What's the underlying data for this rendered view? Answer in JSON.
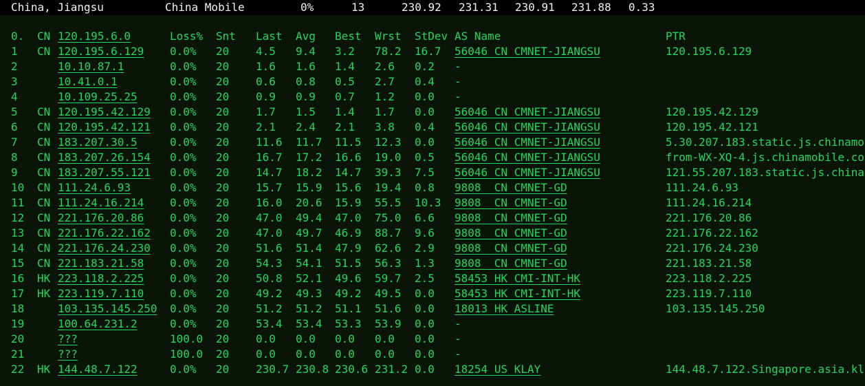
{
  "summary": {
    "location": "China, Jiangsu",
    "isp": "China Mobile",
    "loss": "0%",
    "sent": "13",
    "last": "230.92",
    "avg": "231.31",
    "best": "230.91",
    "worst": "231.88",
    "stdev": "0.33"
  },
  "colors": {
    "terminal_bg": "#0b1409",
    "topbar_bg": "#000000",
    "text_green": "#22d85a",
    "text_white": "#e8e8e8"
  },
  "header": {
    "hop": "0.",
    "cc": "CN",
    "host": "120.195.6.0",
    "loss": "Loss%",
    "snt": "Snt",
    "last": "Last",
    "avg": "Avg",
    "best": "Best",
    "wrst": "Wrst",
    "stdev": "StDev",
    "asname": "AS Name",
    "ptr": "PTR"
  },
  "hops": [
    {
      "hop": "1",
      "cc": "CN",
      "host": "120.195.6.129",
      "loss": "0.0%",
      "snt": "20",
      "last": "4.5",
      "avg": "9.4",
      "best": "3.2",
      "wrst": "78.2",
      "stdev": "16.7",
      "asn": "56046",
      "ascc": "CN",
      "asname": "CMNET-JIANGSU",
      "ptr": "120.195.6.129"
    },
    {
      "hop": "2",
      "cc": "",
      "host": "10.10.87.1",
      "loss": "0.0%",
      "snt": "20",
      "last": "1.6",
      "avg": "1.6",
      "best": "1.4",
      "wrst": "2.6",
      "stdev": "0.2",
      "asn": "-",
      "ascc": "",
      "asname": "",
      "ptr": ""
    },
    {
      "hop": "3",
      "cc": "",
      "host": "10.41.0.1",
      "loss": "0.0%",
      "snt": "20",
      "last": "0.6",
      "avg": "0.8",
      "best": "0.5",
      "wrst": "2.7",
      "stdev": "0.4",
      "asn": "-",
      "ascc": "",
      "asname": "",
      "ptr": ""
    },
    {
      "hop": "4",
      "cc": "",
      "host": "10.109.25.25",
      "loss": "0.0%",
      "snt": "20",
      "last": "0.9",
      "avg": "0.9",
      "best": "0.7",
      "wrst": "1.2",
      "stdev": "0.0",
      "asn": "-",
      "ascc": "",
      "asname": "",
      "ptr": ""
    },
    {
      "hop": "5",
      "cc": "CN",
      "host": "120.195.42.129",
      "loss": "0.0%",
      "snt": "20",
      "last": "1.7",
      "avg": "1.5",
      "best": "1.4",
      "wrst": "1.7",
      "stdev": "0.0",
      "asn": "56046",
      "ascc": "CN",
      "asname": "CMNET-JIANGSU",
      "ptr": "120.195.42.129"
    },
    {
      "hop": "6",
      "cc": "CN",
      "host": "120.195.42.121",
      "loss": "0.0%",
      "snt": "20",
      "last": "2.1",
      "avg": "2.4",
      "best": "2.1",
      "wrst": "3.8",
      "stdev": "0.4",
      "asn": "56046",
      "ascc": "CN",
      "asname": "CMNET-JIANGSU",
      "ptr": "120.195.42.121"
    },
    {
      "hop": "7",
      "cc": "CN",
      "host": "183.207.30.5",
      "loss": "0.0%",
      "snt": "20",
      "last": "11.6",
      "avg": "11.7",
      "best": "11.5",
      "wrst": "12.3",
      "stdev": "0.0",
      "asn": "56046",
      "ascc": "CN",
      "asname": "CMNET-JIANGSU",
      "ptr": "5.30.207.183.static.js.chinamo"
    },
    {
      "hop": "8",
      "cc": "CN",
      "host": "183.207.26.154",
      "loss": "0.0%",
      "snt": "20",
      "last": "16.7",
      "avg": "17.2",
      "best": "16.6",
      "wrst": "19.0",
      "stdev": "0.5",
      "asn": "56046",
      "ascc": "CN",
      "asname": "CMNET-JIANGSU",
      "ptr": "from-WX-XQ-4.js.chinamobile.co"
    },
    {
      "hop": "9",
      "cc": "CN",
      "host": "183.207.55.121",
      "loss": "0.0%",
      "snt": "20",
      "last": "14.7",
      "avg": "18.2",
      "best": "14.7",
      "wrst": "39.3",
      "stdev": "7.5",
      "asn": "56046",
      "ascc": "CN",
      "asname": "CMNET-JIANGSU",
      "ptr": "121.55.207.183.static.js.china"
    },
    {
      "hop": "10",
      "cc": "CN",
      "host": "111.24.6.93",
      "loss": "0.0%",
      "snt": "20",
      "last": "15.7",
      "avg": "15.9",
      "best": "15.6",
      "wrst": "19.4",
      "stdev": "0.8",
      "asn": "9808",
      "ascc": "CN",
      "asname": "CMNET-GD",
      "ptr": "111.24.6.93"
    },
    {
      "hop": "11",
      "cc": "CN",
      "host": "111.24.16.214",
      "loss": "0.0%",
      "snt": "20",
      "last": "16.0",
      "avg": "20.6",
      "best": "15.9",
      "wrst": "55.5",
      "stdev": "10.3",
      "asn": "9808",
      "ascc": "CN",
      "asname": "CMNET-GD",
      "ptr": "111.24.16.214"
    },
    {
      "hop": "12",
      "cc": "CN",
      "host": "221.176.20.86",
      "loss": "0.0%",
      "snt": "20",
      "last": "47.0",
      "avg": "49.4",
      "best": "47.0",
      "wrst": "75.0",
      "stdev": "6.6",
      "asn": "9808",
      "ascc": "CN",
      "asname": "CMNET-GD",
      "ptr": "221.176.20.86"
    },
    {
      "hop": "13",
      "cc": "CN",
      "host": "221.176.22.162",
      "loss": "0.0%",
      "snt": "20",
      "last": "47.0",
      "avg": "49.7",
      "best": "46.9",
      "wrst": "88.7",
      "stdev": "9.6",
      "asn": "9808",
      "ascc": "CN",
      "asname": "CMNET-GD",
      "ptr": "221.176.22.162"
    },
    {
      "hop": "14",
      "cc": "CN",
      "host": "221.176.24.230",
      "loss": "0.0%",
      "snt": "20",
      "last": "51.6",
      "avg": "51.4",
      "best": "47.9",
      "wrst": "62.6",
      "stdev": "2.9",
      "asn": "9808",
      "ascc": "CN",
      "asname": "CMNET-GD",
      "ptr": "221.176.24.230"
    },
    {
      "hop": "15",
      "cc": "CN",
      "host": "221.183.21.58",
      "loss": "0.0%",
      "snt": "20",
      "last": "54.3",
      "avg": "54.1",
      "best": "51.5",
      "wrst": "56.3",
      "stdev": "1.3",
      "asn": "9808",
      "ascc": "CN",
      "asname": "CMNET-GD",
      "ptr": "221.183.21.58"
    },
    {
      "hop": "16",
      "cc": "HK",
      "host": "223.118.2.225",
      "loss": "0.0%",
      "snt": "20",
      "last": "50.8",
      "avg": "52.1",
      "best": "49.6",
      "wrst": "59.7",
      "stdev": "2.5",
      "asn": "58453",
      "ascc": "HK",
      "asname": "CMI-INT-HK",
      "ptr": "223.118.2.225"
    },
    {
      "hop": "17",
      "cc": "HK",
      "host": "223.119.7.110",
      "loss": "0.0%",
      "snt": "20",
      "last": "49.2",
      "avg": "49.3",
      "best": "49.2",
      "wrst": "49.5",
      "stdev": "0.0",
      "asn": "58453",
      "ascc": "HK",
      "asname": "CMI-INT-HK",
      "ptr": "223.119.7.110"
    },
    {
      "hop": "18",
      "cc": "",
      "host": "103.135.145.250",
      "loss": "0.0%",
      "snt": "20",
      "last": "51.2",
      "avg": "51.2",
      "best": "51.1",
      "wrst": "51.6",
      "stdev": "0.0",
      "asn": "18013",
      "ascc": "HK",
      "asname": "ASLINE",
      "ptr": "103.135.145.250"
    },
    {
      "hop": "19",
      "cc": "",
      "host": "100.64.231.2",
      "loss": "0.0%",
      "snt": "20",
      "last": "53.4",
      "avg": "53.4",
      "best": "53.3",
      "wrst": "53.9",
      "stdev": "0.0",
      "asn": "-",
      "ascc": "",
      "asname": "",
      "ptr": ""
    },
    {
      "hop": "20",
      "cc": "",
      "host": "???",
      "loss": "100.0",
      "snt": "20",
      "last": "0.0",
      "avg": "0.0",
      "best": "0.0",
      "wrst": "0.0",
      "stdev": "0.0",
      "asn": "-",
      "ascc": "",
      "asname": "",
      "ptr": ""
    },
    {
      "hop": "21",
      "cc": "",
      "host": "???",
      "loss": "100.0",
      "snt": "20",
      "last": "0.0",
      "avg": "0.0",
      "best": "0.0",
      "wrst": "0.0",
      "stdev": "0.0",
      "asn": "-",
      "ascc": "",
      "asname": "",
      "ptr": ""
    },
    {
      "hop": "22",
      "cc": "HK",
      "host": "144.48.7.122",
      "loss": "0.0%",
      "snt": "20",
      "last": "230.7",
      "avg": "230.8",
      "best": "230.6",
      "wrst": "231.2",
      "stdev": "0.0",
      "asn": "18254",
      "ascc": "US",
      "asname": "KLAY",
      "ptr": "144.48.7.122.Singapore.asia.kl"
    }
  ]
}
